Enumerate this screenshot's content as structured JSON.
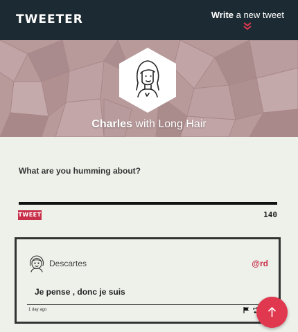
{
  "nav": {
    "brand": "TWEETER",
    "compose_bold": "Write",
    "compose_rest": " a new tweet",
    "compose_icon": "double-chevron-down-icon"
  },
  "profile": {
    "first_name": "Charles",
    "name_suffix": " with Long Hair",
    "avatar_icon": "long-hair-avatar-icon"
  },
  "composer": {
    "prompt": "What are you humming about?",
    "value": "",
    "button_label": "TWEET",
    "char_count": "140"
  },
  "tweets": [
    {
      "author_name": "Descartes",
      "handle": "@rd",
      "text": "Je pense , donc je suis",
      "time": "1 day ago",
      "avatar_icon": "user-avatar-icon",
      "actions": [
        "flag-icon",
        "retweet-icon"
      ]
    }
  ],
  "fab": {
    "icon": "arrow-up-icon"
  },
  "colors": {
    "nav_bg": "#1c2a33",
    "page_bg": "#eef1ea",
    "accent": "#c8304a",
    "fab": "#e0384f"
  }
}
